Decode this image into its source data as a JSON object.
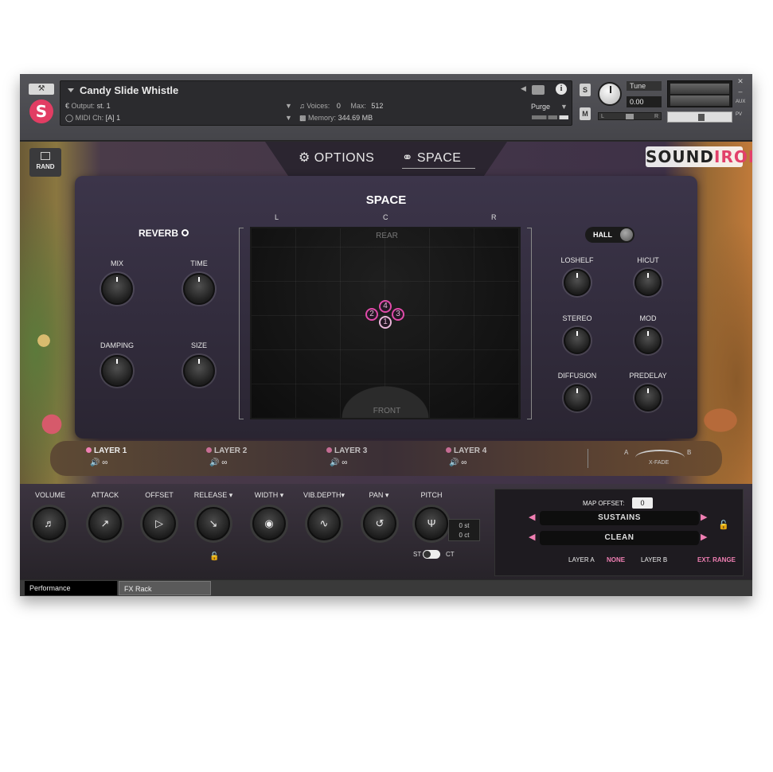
{
  "header": {
    "instrument_name": "Candy Slide Whistle",
    "output_label": "Output:",
    "output_value": "st. 1",
    "midi_label": "MIDI Ch:",
    "midi_value": "[A] 1",
    "voices_label": "Voices:",
    "voices_value": "0",
    "max_label": "Max:",
    "max_value": "512",
    "memory_label": "Memory:",
    "memory_value": "344.69 MB",
    "purge_label": "Purge",
    "solo_label": "S",
    "mute_label": "M",
    "tune_label": "Tune",
    "tune_value": "0.00",
    "pan_left": "L",
    "pan_right": "R",
    "aux_label": "AUX",
    "pv_label": "PV"
  },
  "nav": {
    "rand_label": "RAND",
    "options_tab": "OPTIONS",
    "space_tab": "SPACE",
    "brand_sound": "SOUND",
    "brand_iron": "IRON"
  },
  "space_panel": {
    "title": "SPACE",
    "reverb_label": "REVERB",
    "mix_label": "MIX",
    "time_label": "TIME",
    "damping_label": "DAMPING",
    "size_label": "SIZE",
    "pos_left": "L",
    "pos_center": "C",
    "pos_right": "R",
    "rear_label": "REAR",
    "front_label": "FRONT",
    "layer_markers": [
      "4",
      "2",
      "3",
      "1"
    ],
    "hall_label": "HALL",
    "loshelf_label": "LOSHELF",
    "hicut_label": "HICUT",
    "stereo_label": "STEREO",
    "mod_label": "MOD",
    "diffusion_label": "DIFFUSION",
    "predelay_label": "PREDELAY"
  },
  "layers": {
    "items": [
      "LAYER 1",
      "LAYER 2",
      "LAYER 3",
      "LAYER 4"
    ],
    "xfade_a": "A",
    "xfade_b": "B",
    "xfade_label": "X-FADE",
    "active_dot_color": "#f07fb3"
  },
  "controls": {
    "volume": "VOLUME",
    "attack": "ATTACK",
    "offset": "OFFSET",
    "release": "RELEASE",
    "width": "WIDTH",
    "vib_depth": "VIB.DEPTH",
    "pan": "PAN",
    "pitch": "PITCH",
    "pitch_st": "0 st",
    "pitch_ct": "0 ct",
    "st_label": "ST",
    "ct_label": "CT"
  },
  "mapping": {
    "map_offset_label": "MAP OFFSET:",
    "map_offset_value": "0",
    "articulation": "SUSTAINS",
    "variation": "CLEAN",
    "layer_a_label": "LAYER A",
    "layer_a_value": "NONE",
    "layer_b_label": "LAYER B",
    "ext_range_label": "EXT. RANGE",
    "accent_color": "#f07fb3"
  },
  "footer": {
    "performance_tab": "Performance",
    "fx_rack_tab": "FX Rack"
  }
}
